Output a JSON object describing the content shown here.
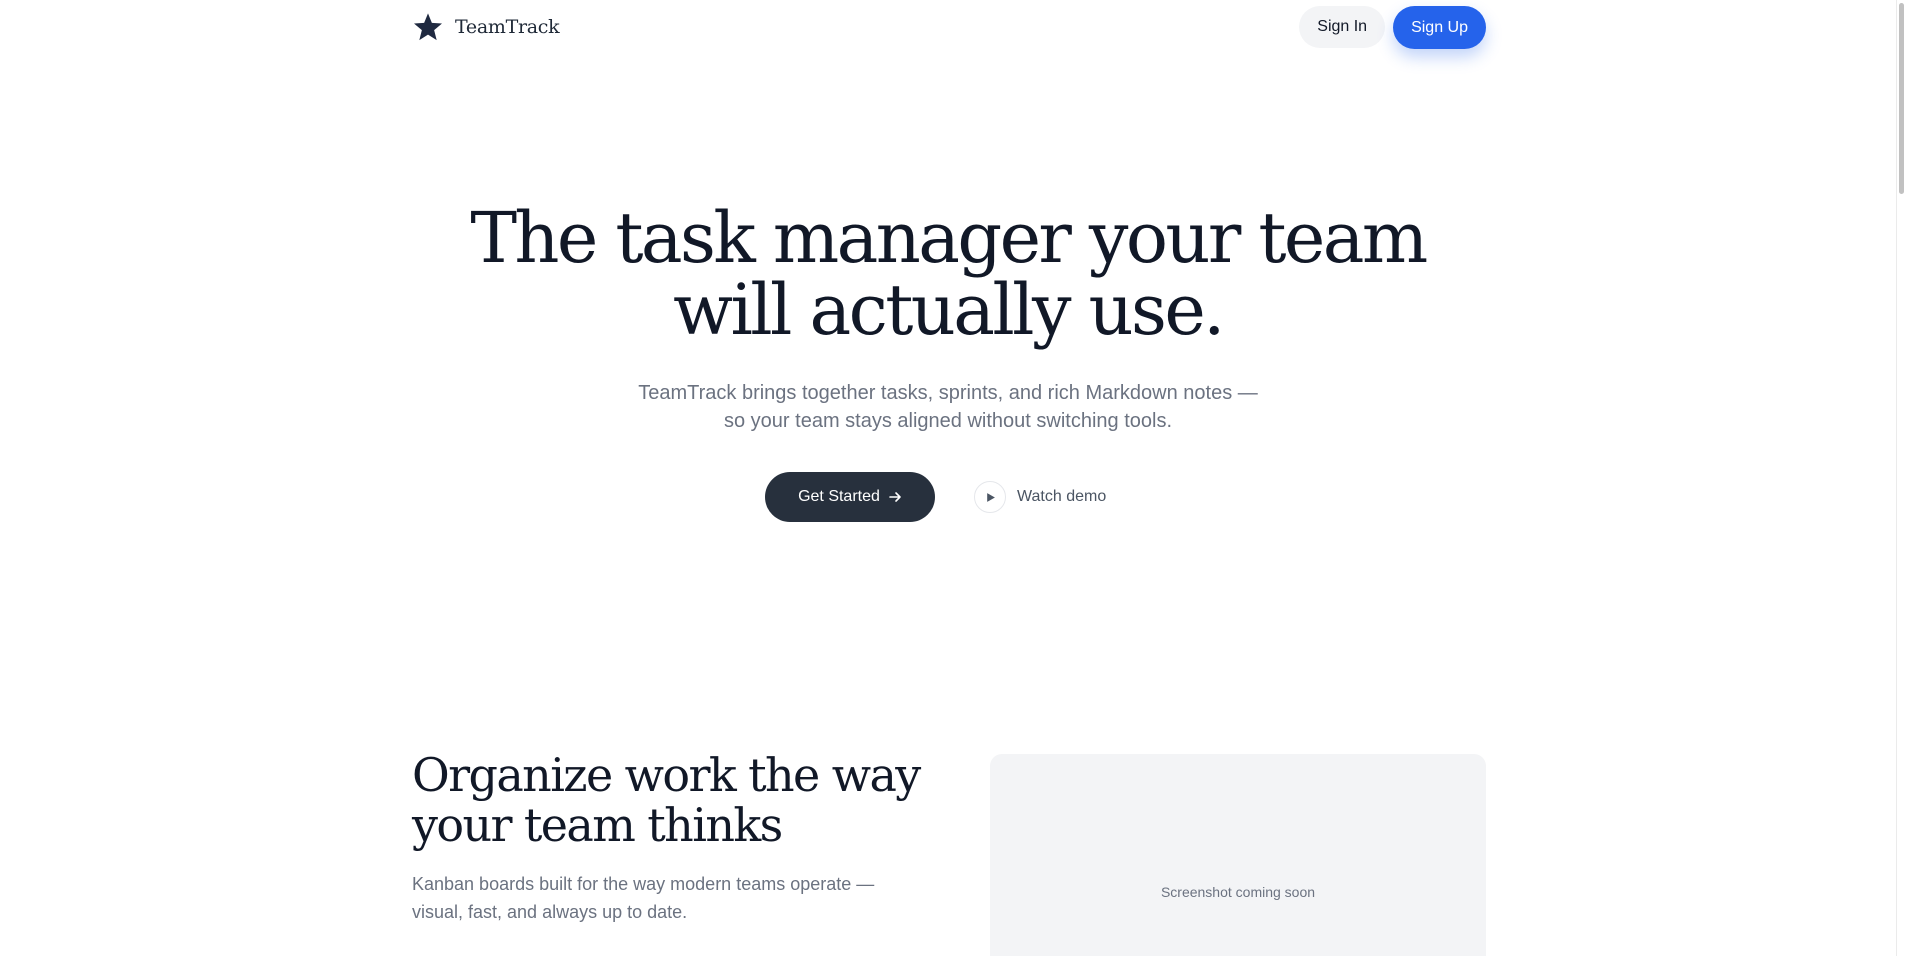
{
  "header": {
    "brand_name": "TeamTrack",
    "brand_icon": "star-icon",
    "signin_label": "Sign In",
    "signup_label": "Sign Up"
  },
  "hero": {
    "title_line1": "The task manager your team",
    "title_line2": "will actually use.",
    "subtitle_line1": "TeamTrack brings together tasks, sprints, and rich Markdown notes —",
    "subtitle_line2": "so your team stays aligned without switching tools.",
    "cta_label": "Get Started",
    "cta_icon": "arrow-right-icon",
    "demo_label": "Watch demo",
    "demo_icon": "play-icon"
  },
  "feature": {
    "title_line1": "Organize work the way",
    "title_line2": "your team thinks",
    "desc_line1": "Kanban boards built for the way modern teams operate —",
    "desc_line2": "visual, fast, and always up to date.",
    "screenshot_placeholder": "Screenshot coming soon"
  },
  "colors": {
    "accent": "#2563eb",
    "primary_dark": "#27303d",
    "text_heading": "#111827",
    "text_muted": "#6b7280",
    "placeholder_bg": "#f3f4f6"
  }
}
